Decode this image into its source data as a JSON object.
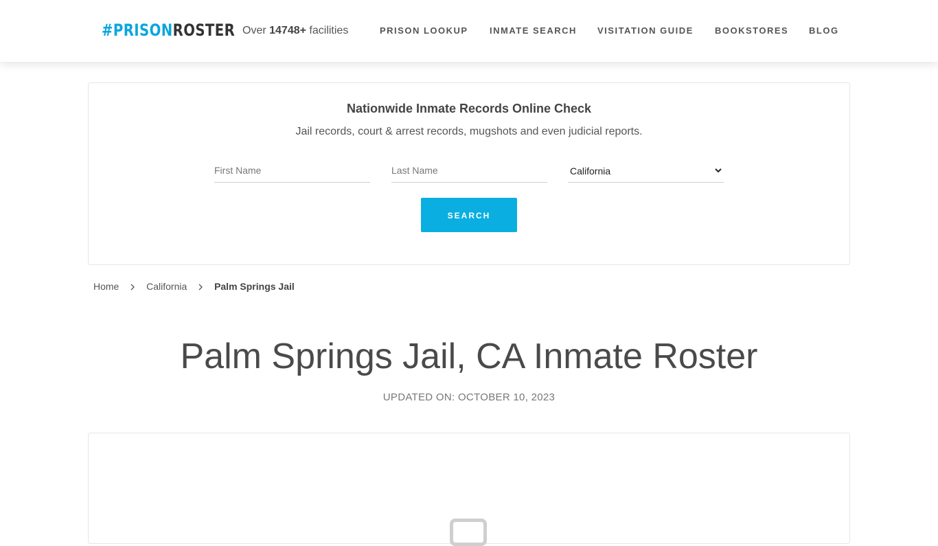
{
  "header": {
    "logo_hash": "#PRISON",
    "logo_rest": "ROSTER",
    "facilities_prefix": "Over",
    "facilities_count": "14748+",
    "facilities_suffix": "facilities",
    "nav": [
      "PRISON LOOKUP",
      "INMATE SEARCH",
      "VISITATION GUIDE",
      "BOOKSTORES",
      "BLOG"
    ]
  },
  "search": {
    "title": "Nationwide Inmate Records Online Check",
    "subtitle": "Jail records, court & arrest records, mugshots and even judicial reports.",
    "first_name_placeholder": "First Name",
    "last_name_placeholder": "Last Name",
    "state_value": "California",
    "button_label": "SEARCH"
  },
  "breadcrumb": {
    "home": "Home",
    "state": "California",
    "current": "Palm Springs Jail"
  },
  "page": {
    "title": "Palm Springs Jail, CA Inmate Roster",
    "updated": "UPDATED ON: OCTOBER 10, 2023"
  },
  "colors": {
    "accent": "#0aaee0",
    "logo_blue": "#0aa6dc",
    "text": "#555555"
  }
}
